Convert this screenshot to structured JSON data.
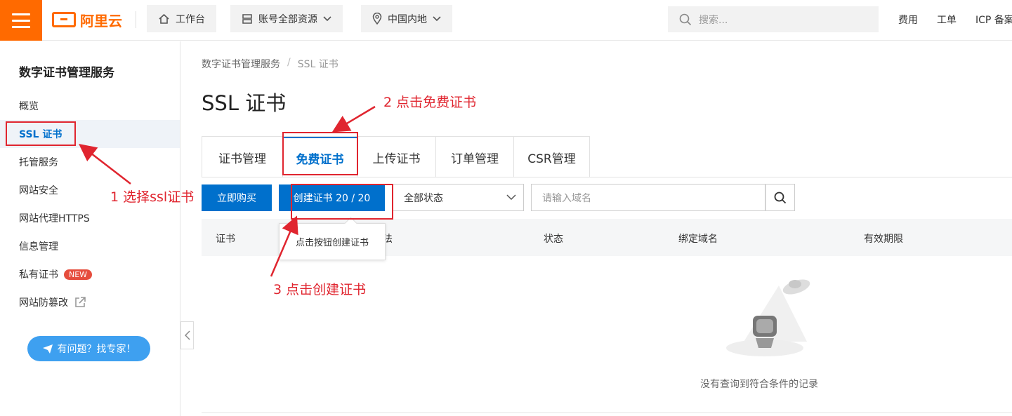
{
  "topbar": {
    "logo_text": "阿里云",
    "workbench": "工作台",
    "resources": "账号全部资源",
    "region": "中国内地",
    "search_placeholder": "搜索...",
    "links": [
      "费用",
      "工单",
      "ICP 备案"
    ]
  },
  "sidebar": {
    "title": "数字证书管理服务",
    "items": [
      {
        "label": "概览"
      },
      {
        "label": "SSL 证书"
      },
      {
        "label": "托管服务"
      },
      {
        "label": "网站安全"
      },
      {
        "label": "网站代理HTTPS"
      },
      {
        "label": "信息管理"
      },
      {
        "label": "私有证书",
        "badge": "NEW"
      },
      {
        "label": "网站防篡改"
      }
    ],
    "expert_button": "有问题？找专家！"
  },
  "breadcrumb": {
    "items": [
      "数字证书管理服务",
      "SSL 证书"
    ],
    "separator": "/"
  },
  "page_title": "SSL 证书",
  "tabs": [
    "证书管理",
    "免费证书",
    "上传证书",
    "订单管理",
    "CSR管理"
  ],
  "toolbar": {
    "buy_label": "立即购买",
    "create_label": "创建证书 20 / 20",
    "status_select": "全部状态",
    "domain_placeholder": "请输入域名"
  },
  "tooltip": "点击按钮创建证书",
  "table": {
    "columns": [
      "证书",
      "法",
      "状态",
      "绑定域名",
      "有效期限"
    ],
    "empty_text": "没有查询到符合条件的记录"
  },
  "annotations": {
    "step1": "1 选择ssl证书",
    "step2": "2 点击免费证书",
    "step3": "3 点击创建证书"
  },
  "colors": {
    "brand_orange": "#ff6a00",
    "primary_blue": "#0070cc",
    "annotation_red": "#e0252f"
  }
}
